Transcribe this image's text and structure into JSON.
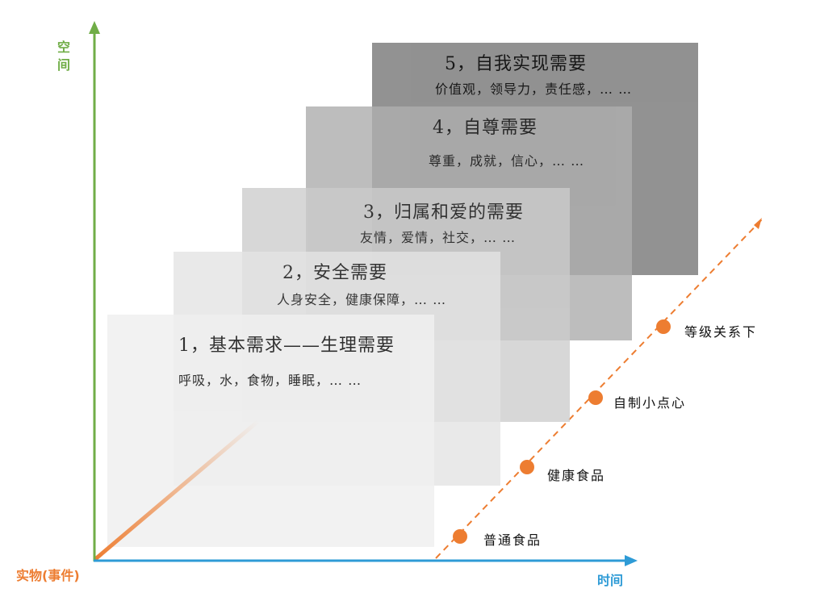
{
  "axes": {
    "vertical_label": "空间",
    "horizontal_label": "时间",
    "origin_label": "实物(事件)",
    "vertical_color": "#70AD47",
    "horizontal_color": "#2E9BD6",
    "origin_color": "#ED7D31"
  },
  "layers": [
    {
      "title": "1，基本需求——生理需要",
      "items": "呼吸，水，食物，睡眠，… …",
      "color": "#F0F0F0"
    },
    {
      "title": "2，安全需要",
      "items": "人身安全，健康保障，… …",
      "color": "#E4E4E4"
    },
    {
      "title": "3，归属和爱的需要",
      "items": "友情，爱情，社交，… …",
      "color": "#CCCCCC"
    },
    {
      "title": "4，自尊需要",
      "items": "尊重，成就，信心，… …",
      "color": "#AEAEAE"
    },
    {
      "title": "5，自我实现需要",
      "items": "价值观，领导力，责任感，… …",
      "color": "#8E8E8E"
    }
  ],
  "levels": [
    {
      "label": "普通食品"
    },
    {
      "label": "健康食品"
    },
    {
      "label": "自制小点心"
    },
    {
      "label": "等级关系下"
    }
  ],
  "level_color": "#ED7D31"
}
